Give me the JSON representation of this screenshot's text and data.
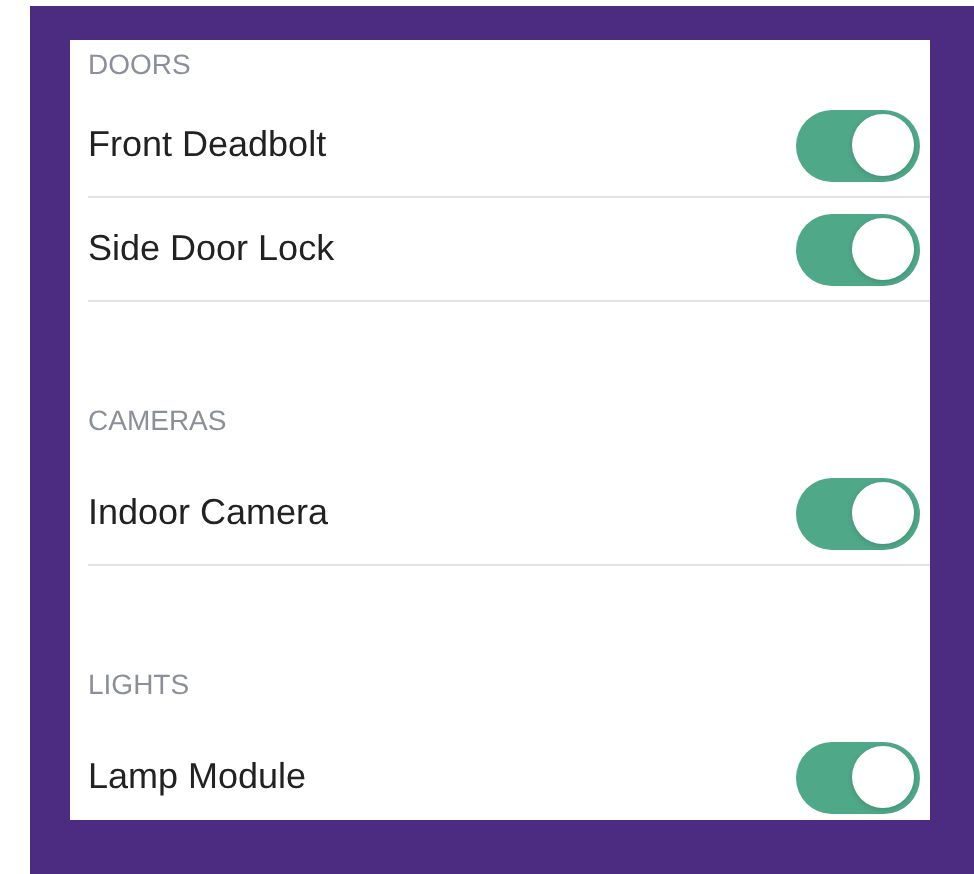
{
  "sections": [
    {
      "header": "DOORS",
      "items": [
        {
          "label": "Front Deadbolt",
          "on": true
        },
        {
          "label": "Side Door Lock",
          "on": true
        }
      ]
    },
    {
      "header": "CAMERAS",
      "items": [
        {
          "label": "Indoor Camera",
          "on": true
        }
      ]
    },
    {
      "header": "LIGHTS",
      "items": [
        {
          "label": "Lamp Module",
          "on": true
        }
      ]
    }
  ]
}
